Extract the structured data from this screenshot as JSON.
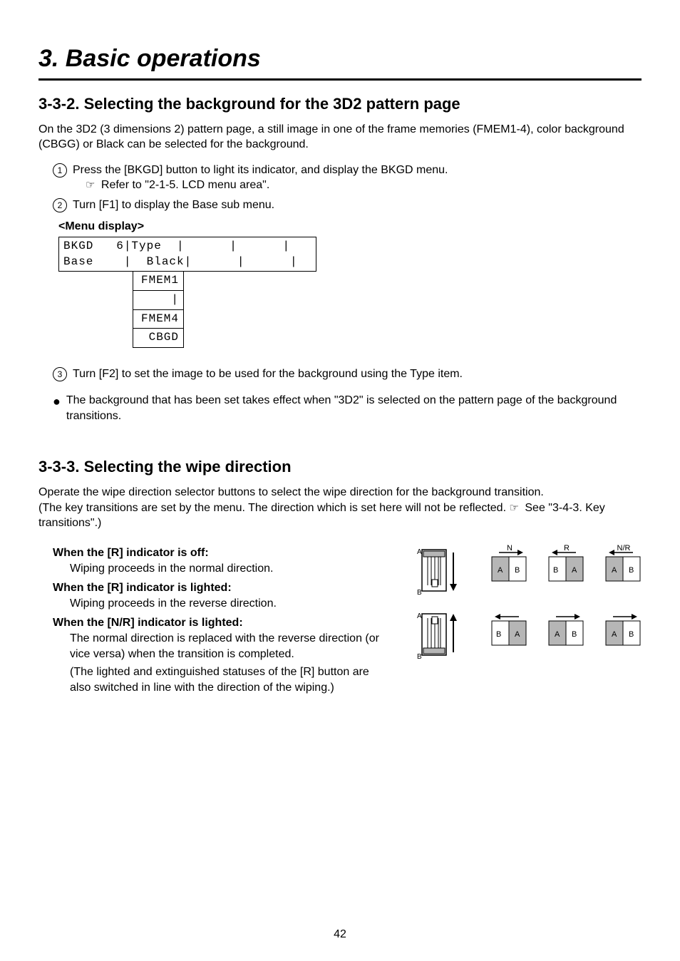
{
  "chapter": {
    "title": "3. Basic operations"
  },
  "section1": {
    "title": "3-3-2. Selecting the background for the 3D2 pattern page",
    "intro": "On the 3D2 (3 dimensions 2) pattern page, a still image in one of the frame memories (FMEM1-4), color background (CBGG) or Black can be selected for the background.",
    "step1_num": "1",
    "step1": "Press the [BKGD] button to light its indicator, and display the BKGD menu.",
    "refer_icon": "☞",
    "refer": "Refer to \"2-1-5. LCD menu area\".",
    "step2_num": "2",
    "step2": "Turn [F1] to display the Base sub menu.",
    "menu_heading": "<Menu display>",
    "menu_row1": "BKGD   6|Type  |      |      |",
    "menu_row2": "Base    |  Black|      |      |",
    "menu_sub1": "FMEM1",
    "menu_sub2": "|",
    "menu_sub3": "FMEM4",
    "menu_sub4": " CBGD",
    "step3_num": "3",
    "step3": "Turn [F2] to set the image to be used for the background using the Type item.",
    "bullet": "The background that has been set takes effect when \"3D2\" is selected on the pattern page of the background transitions."
  },
  "section2": {
    "title": "3-3-3. Selecting the wipe direction",
    "para1": "Operate the wipe direction selector buttons to select the wipe direction for the background transition.",
    "para2_a": "(The key transitions are set by the menu. The direction which is set here will not be reflected. ",
    "para2_icon": "☞",
    "para2_b": " See \"3-4-3. Key transitions\".)",
    "h1": "When the [R] indicator is off:",
    "d1": "Wiping proceeds in the normal direction.",
    "h2": "When the [R] indicator is lighted:",
    "d2": "Wiping proceeds in the reverse direction.",
    "h3": "When the [N/R] indicator is lighted:",
    "d3a": "The normal direction is replaced with the reverse direction (or vice versa) when the transition is completed.",
    "d3b": "(The lighted and extinguished statuses of the [R] button are also switched in line with the direction of the wiping.)"
  },
  "diagram": {
    "top_labels": {
      "col2": "N",
      "col3": "R",
      "col4": "N/R"
    },
    "lever_A": "A",
    "lever_B": "B",
    "cell_A": "A",
    "cell_B": "B"
  },
  "page_number": "42"
}
